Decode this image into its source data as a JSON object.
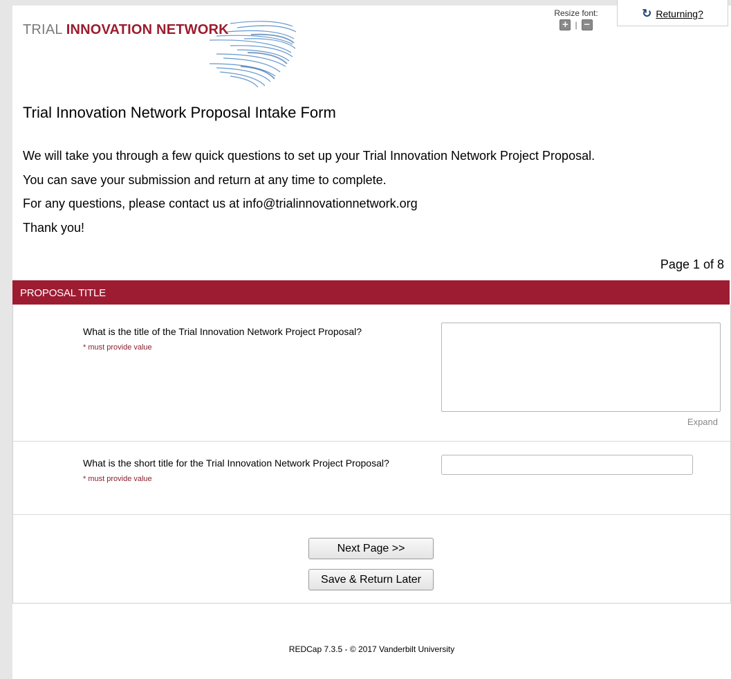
{
  "logo": {
    "text_light": "TRIAL ",
    "text_bold": "INNOVATION NETWORK"
  },
  "resize": {
    "label": "Resize font:",
    "plus": "+",
    "separator": "|",
    "minus": "−"
  },
  "returning": {
    "icon": "refresh-icon",
    "label": "Returning?"
  },
  "form": {
    "title": "Trial Innovation Network Proposal Intake Form",
    "intro": [
      "We will take you through a few quick questions to set up your Trial Innovation Network Project Proposal.",
      "You can save your submission and return at any time to complete.",
      "For any questions, please contact us at info@trialinnovationnetwork.org",
      "Thank you!"
    ],
    "page_indicator": "Page 1 of 8"
  },
  "section": {
    "title": "PROPOSAL TITLE"
  },
  "questions": [
    {
      "label": "What is the title of the Trial Innovation Network Project Proposal?",
      "required_note": "* must provide value",
      "value": "",
      "expand_label": "Expand"
    },
    {
      "label": "What is the short title for the Trial Innovation Network Project Proposal?",
      "required_note": "* must provide value",
      "value": ""
    }
  ],
  "buttons": {
    "next": "Next Page >>",
    "save": "Save & Return Later"
  },
  "footer": {
    "text": "REDCap 7.3.5 - © 2017 Vanderbilt University"
  },
  "colors": {
    "brand": "#9d1c32",
    "logo_lines": "#4a86c5"
  }
}
